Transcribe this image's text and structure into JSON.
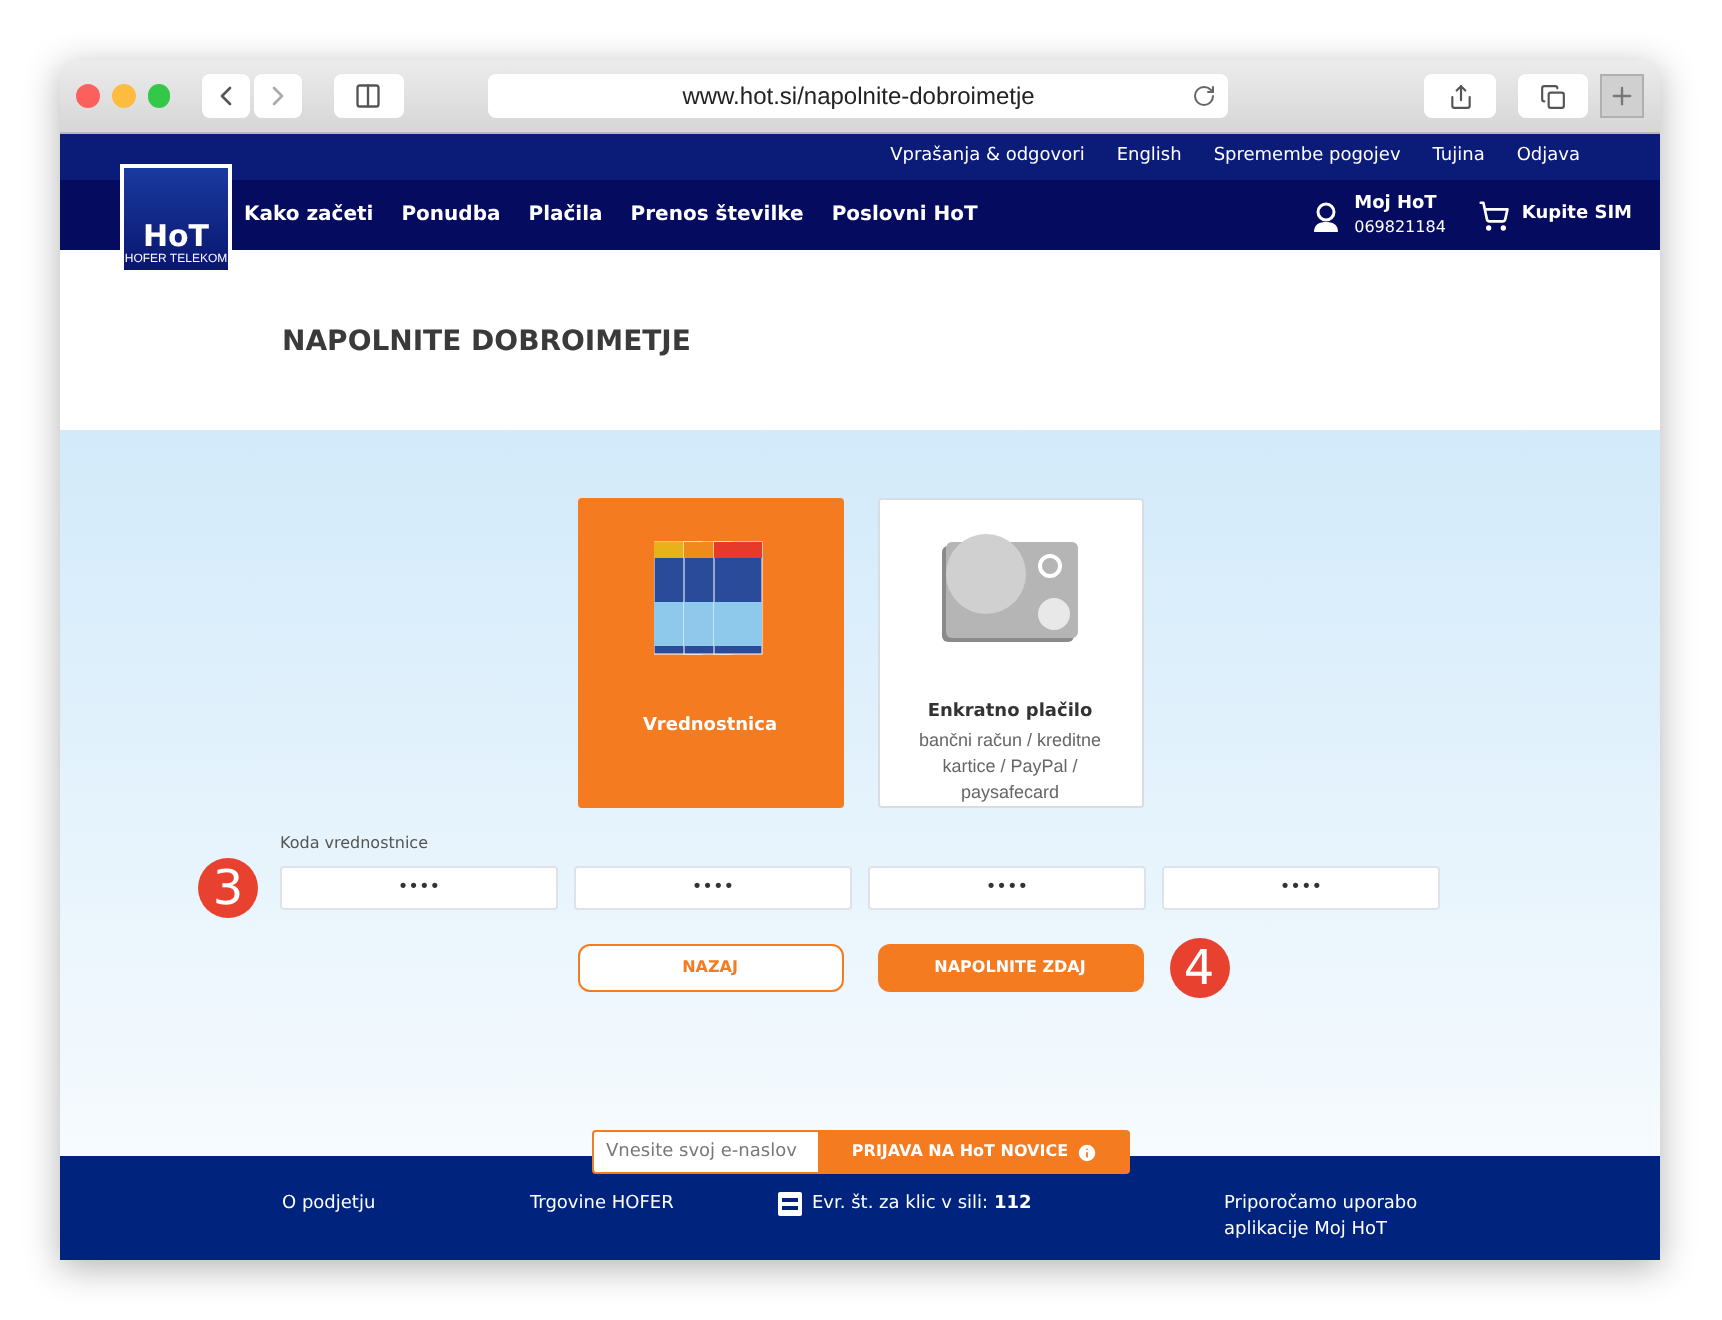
{
  "browser": {
    "url": "www.hot.si/napolnite-dobroimetje"
  },
  "logo": {
    "text": "HoT",
    "subtext": "HOFER TELEKOM"
  },
  "top_links": [
    "Vprašanja & odgovori",
    "English",
    "Spremembe pogojev",
    "Tujina",
    "Odjava"
  ],
  "nav": [
    "Kako začeti",
    "Ponudba",
    "Plačila",
    "Prenos številke",
    "Poslovni HoT"
  ],
  "account": {
    "name": "Moj HoT",
    "number": "069821184"
  },
  "cart": {
    "label": "Kupite SIM"
  },
  "title": "NAPOLNITE DOBROIMETJE",
  "payment_options": [
    {
      "kind": "voucher",
      "title": "Vrednostnica",
      "selected": true
    },
    {
      "kind": "card",
      "title": "Enkratno plačilo",
      "description": "bančni račun / kreditne kartice / PayPal / paysafecard",
      "selected": false
    }
  ],
  "code_label": "Koda vrednostnice",
  "code_fields": [
    {
      "placeholder": "••••"
    },
    {
      "placeholder": "••••"
    },
    {
      "placeholder": "••••"
    },
    {
      "placeholder": "••••"
    }
  ],
  "step_badges": [
    "3",
    "4"
  ],
  "buttons": [
    {
      "kind": "outline",
      "label": "NAZAJ"
    },
    {
      "kind": "primary",
      "label": "NAPOLNITE ZDAJ"
    }
  ],
  "newsletter": {
    "placeholder": "Vnesite svoj e-naslov",
    "button": "PRIJAVA NA HoT NOVICE"
  },
  "footer": [
    {
      "kind": "link",
      "text": "O podjetju"
    },
    {
      "kind": "link",
      "text": "Trgovine HOFER"
    },
    {
      "kind": "emergency",
      "text": "Evr. št. za klic v sili: **112**"
    },
    {
      "kind": "link",
      "text": "Priporočamo uporabo aplikacije Moj HoT"
    }
  ]
}
